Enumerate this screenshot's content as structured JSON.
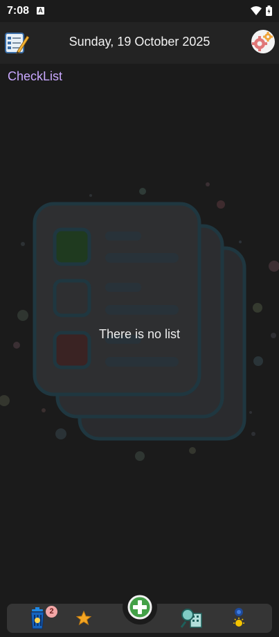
{
  "status_bar": {
    "time": "7:08",
    "notification_icon": "a-icon",
    "wifi_icon": "wifi-icon",
    "battery_icon": "battery-icon"
  },
  "header": {
    "date": "Sunday, 19 October 2025",
    "left_icon": "checklist-edit-icon",
    "right_icon": "settings-gears-icon"
  },
  "section": {
    "title": "CheckList"
  },
  "empty_state": {
    "message": "There is no list"
  },
  "bottom_nav": {
    "items": [
      {
        "icon": "trash-icon",
        "badge": "2"
      },
      {
        "icon": "star-icon"
      },
      {
        "icon": "add-icon"
      },
      {
        "icon": "search-building-icon"
      },
      {
        "icon": "theme-icon"
      }
    ]
  },
  "colors": {
    "background": "#1b1b1b",
    "header": "#232323",
    "accent_title": "#c9a8ff",
    "nav": "#353535"
  }
}
